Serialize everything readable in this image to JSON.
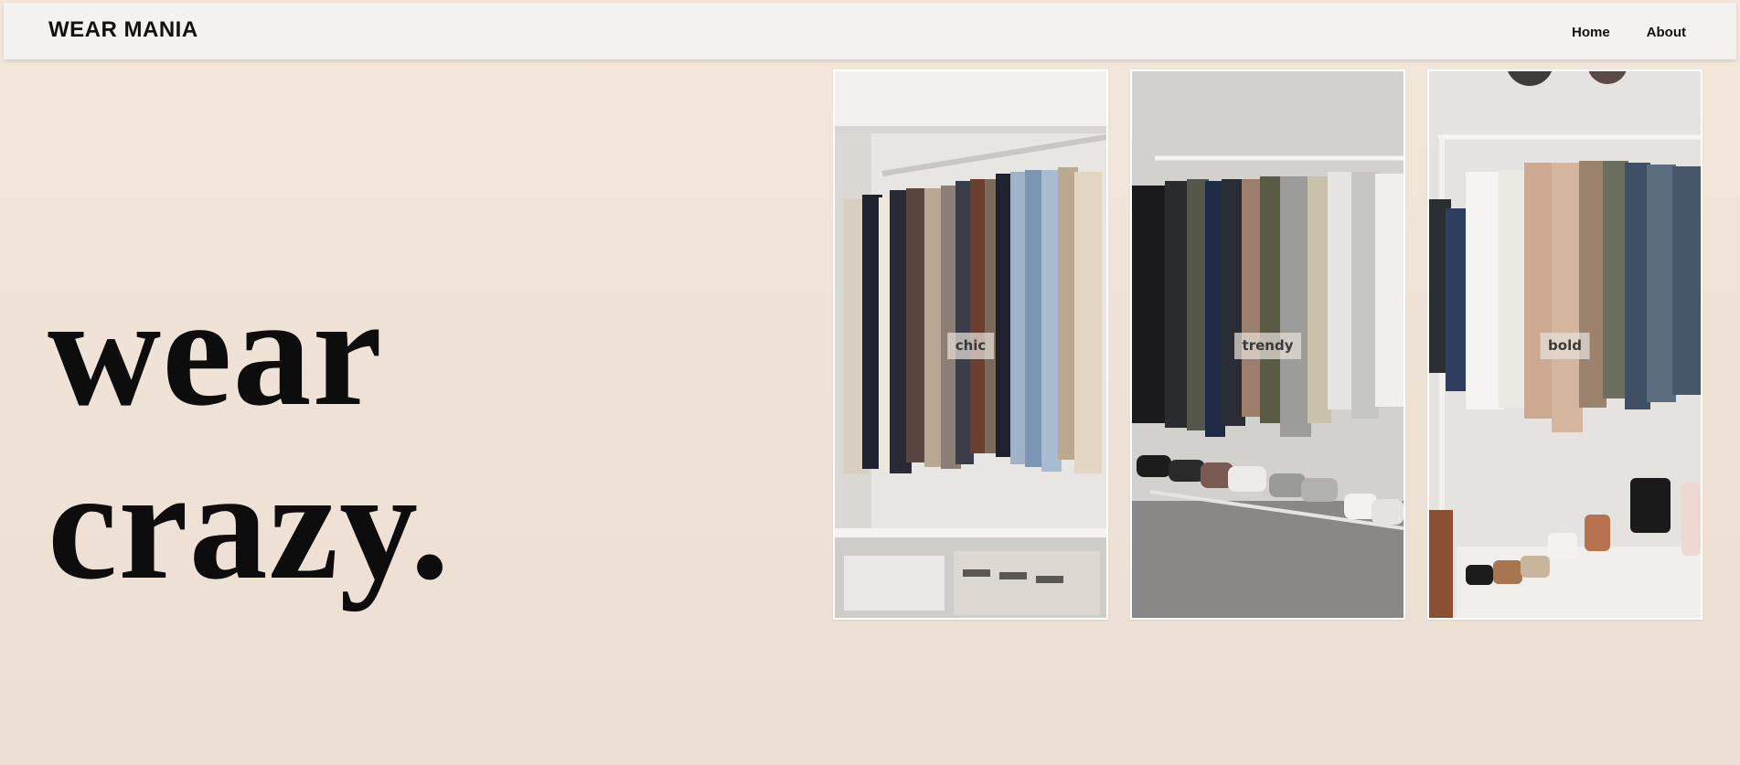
{
  "header": {
    "brand": "WEAR MANIA",
    "nav": [
      {
        "label": "Home"
      },
      {
        "label": "About"
      }
    ]
  },
  "hero": {
    "line1": "wear",
    "line2": "crazy."
  },
  "gallery": [
    {
      "label": "chic",
      "image": "closet-jackets-photo"
    },
    {
      "label": "trendy",
      "image": "clothing-rack-sneakers-photo"
    },
    {
      "label": "bold",
      "image": "clothing-rack-shoes-photo"
    }
  ],
  "colors": {
    "background_top": "#f3e7dc",
    "background_bottom": "#ecdfd3",
    "header_bg": "#f3f2ee",
    "text": "#111111"
  }
}
